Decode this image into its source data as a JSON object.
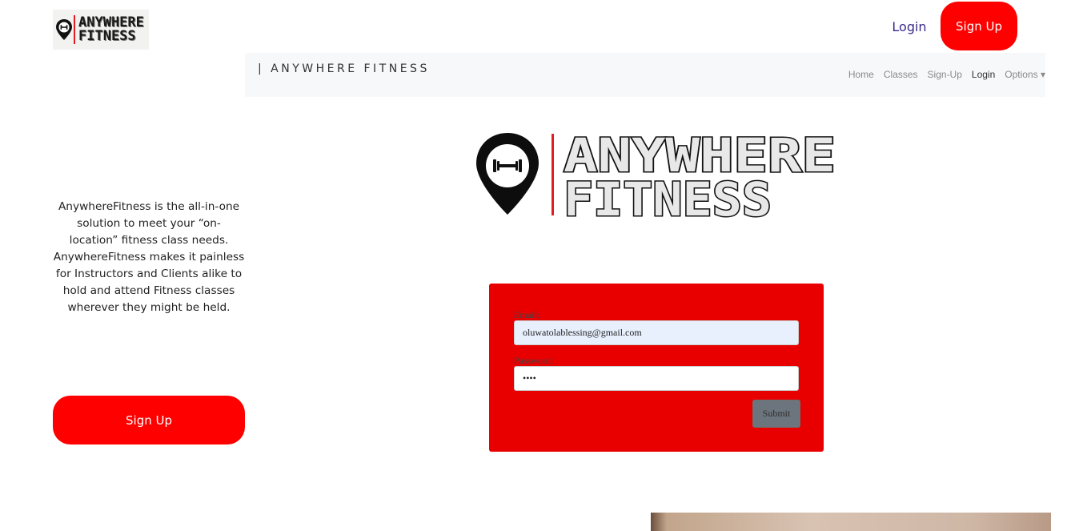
{
  "header": {
    "logo_alt_lines": [
      "ANYWHERE",
      "FITNESS"
    ],
    "login_label": "Login",
    "signup_label": "Sign Up"
  },
  "site_nav": {
    "brand": "| ANYWHERE FITNESS",
    "links": [
      "Home",
      "Classes",
      "Sign-Up",
      "Login",
      "Options ▾"
    ],
    "active": "Login"
  },
  "hero_logo": {
    "line1": "ANYWHERE",
    "line2": "FITNESS"
  },
  "about": {
    "text": "AnywhereFitness is the all-in-one solution to meet your “on-location” fitness class needs. AnywhereFitness makes it painless for Instructors and Clients alike to hold and attend Fitness classes wherever they might be held."
  },
  "left_signup_label": "Sign Up",
  "login_form": {
    "email_label": "Email:",
    "email_value": "oluwatolablessing@gmail.com",
    "password_label": "Password:",
    "password_value": "••••",
    "submit_label": "Submit"
  },
  "colors": {
    "brand_red": "#ff0000",
    "card_red": "#e80000",
    "login_link": "#3b2a8a"
  }
}
